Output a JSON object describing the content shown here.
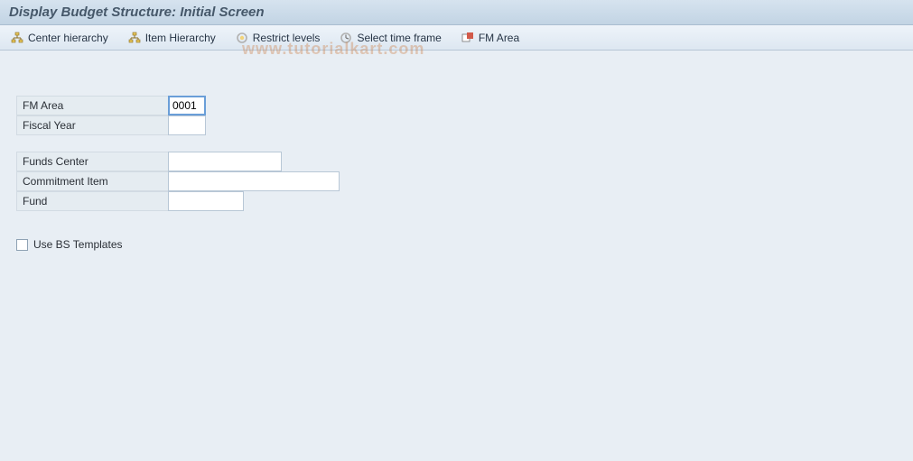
{
  "title": "Display Budget Structure: Initial Screen",
  "toolbar": {
    "center_hierarchy": "Center hierarchy",
    "item_hierarchy": "Item Hierarchy",
    "restrict_levels": "Restrict levels",
    "select_time": "Select time frame",
    "fm_area": "FM Area"
  },
  "fields": {
    "fm_area": {
      "label": "FM Area",
      "value": "0001"
    },
    "fiscal_year": {
      "label": "Fiscal Year",
      "value": ""
    },
    "funds_center": {
      "label": "Funds Center",
      "value": ""
    },
    "commitment_item": {
      "label": "Commitment Item",
      "value": ""
    },
    "fund": {
      "label": "Fund",
      "value": ""
    }
  },
  "checkbox": {
    "use_bs_templates": {
      "label": "Use BS Templates",
      "checked": false
    }
  },
  "watermark": "www.tutorialkart.com"
}
